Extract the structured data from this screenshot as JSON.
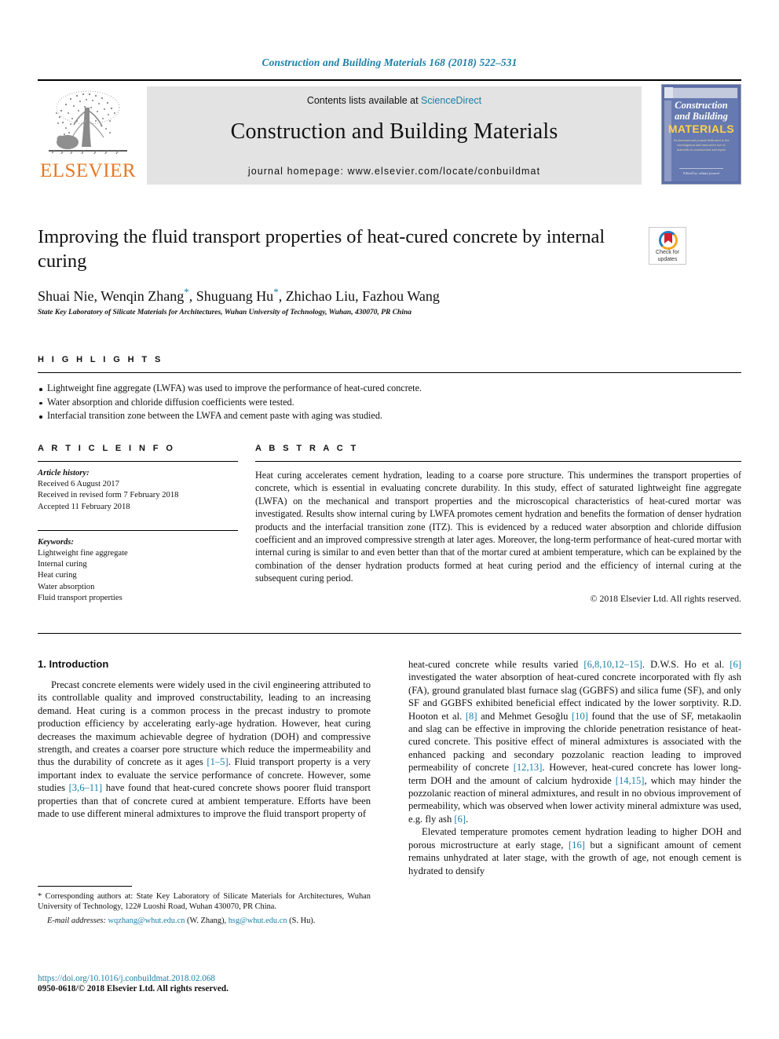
{
  "running_head": "Construction and Building Materials 168 (2018) 522–531",
  "masthead": {
    "publisher": "ELSEVIER",
    "contents_prefix": "Contents lists available at ",
    "contents_link": "ScienceDirect",
    "journal_name": "Construction and Building Materials",
    "homepage": "journal homepage: www.elsevier.com/locate/conbuildmat",
    "cover": {
      "line1": "Construction",
      "line2": "and Building",
      "line3": "MATERIALS",
      "blurb": "An international journal dedicated to the investigation and innovative use of materials in construction and repair",
      "foot": "Edited by: admin journal"
    }
  },
  "article": {
    "title": "Improving the fluid transport properties of heat-cured concrete by internal curing",
    "authors_html": "Shuai Nie, Wenqin Zhang *, Shuguang Hu *, Zhichao Liu, Fazhou Wang",
    "affiliation": "State Key Laboratory of Silicate Materials for Architectures, Wuhan University of Technology, Wuhan, 430070, PR China",
    "crossmark_label": "Check for updates"
  },
  "highlights": {
    "heading": "H I G H L I G H T S",
    "items": [
      "Lightweight fine aggregate (LWFA) was used to improve the performance of heat-cured concrete.",
      "Water absorption and chloride diffusion coefficients were tested.",
      "Interfacial transition zone between the LWFA and cement paste with aging was studied."
    ]
  },
  "article_info": {
    "heading": "A R T I C L E   I N F O",
    "history_label": "Article history:",
    "history": [
      "Received 6 August 2017",
      "Received in revised form 7 February 2018",
      "Accepted 11 February 2018"
    ],
    "keywords_label": "Keywords:",
    "keywords": [
      "Lightweight fine aggregate",
      "Internal curing",
      "Heat curing",
      "Water absorption",
      "Fluid transport properties"
    ]
  },
  "abstract": {
    "heading": "A B S T R A C T",
    "text": "Heat curing accelerates cement hydration, leading to a coarse pore structure. This undermines the transport properties of concrete, which is essential in evaluating concrete durability. In this study, effect of saturated lightweight fine aggregate (LWFA) on the mechanical and transport properties and the microscopical characteristics of heat-cured mortar was investigated. Results show internal curing by LWFA promotes cement hydration and benefits the formation of denser hydration products and the interfacial transition zone (ITZ). This is evidenced by a reduced water absorption and chloride diffusion coefficient and an improved compressive strength at later ages. Moreover, the long-term performance of heat-cured mortar with internal curing is similar to and even better than that of the mortar cured at ambient temperature, which can be explained by the combination of the denser hydration products formed at heat curing period and the efficiency of internal curing at the subsequent curing period.",
    "copyright": "© 2018 Elsevier Ltd. All rights reserved."
  },
  "body": {
    "section_heading": "1. Introduction",
    "left_paragraph_1": "Precast concrete elements were widely used in the civil engineering attributed to its controllable quality and improved constructability, leading to an increasing demand. Heat curing is a common process in the precast industry to promote production efficiency by accelerating early-age hydration. However, heat curing decreases the maximum achievable degree of hydration (DOH) and compressive strength, and creates a coarser pore structure which reduce the impermeability and thus the durability of concrete as it ages ",
    "left_ref_1": "[1–5]",
    "left_paragraph_1b": ". Fluid transport property is a very important index to evaluate the service performance of concrete. However, some studies ",
    "left_ref_2": "[3,6–11]",
    "left_paragraph_1c": " have found that heat-cured concrete shows poorer fluid transport properties than that of concrete cured at ambient temperature. Efforts have been made to use different mineral admixtures to improve the fluid transport property of",
    "right_paragraph_1a": "heat-cured concrete while results varied ",
    "right_ref_1": "[6,8,10,12–15]",
    "right_paragraph_1b": ". D.W.S. Ho et al. ",
    "right_ref_2": "[6]",
    "right_paragraph_1c": " investigated the water absorption of heat-cured concrete incorporated with fly ash (FA), ground granulated blast furnace slag (GGBFS) and silica fume (SF), and only SF and GGBFS exhibited beneficial effect indicated by the lower sorptivity. R.D. Hooton et al. ",
    "right_ref_3": "[8]",
    "right_paragraph_1d": " and Mehmet Gesoğlu ",
    "right_ref_4": "[10]",
    "right_paragraph_1e": " found that the use of SF, metakaolin and slag can be effective in improving the chloride penetration resistance of heat-cured concrete. This positive effect of mineral admixtures is associated with the enhanced packing and secondary pozzolanic reaction leading to improved permeability of concrete ",
    "right_ref_5": "[12,13]",
    "right_paragraph_1f": ". However, heat-cured concrete has lower long-term DOH and the amount of calcium hydroxide ",
    "right_ref_6": "[14,15]",
    "right_paragraph_1g": ", which may hinder the pozzolanic reaction of mineral admixtures, and result in no obvious improvement of permeability, which was observed when lower activity mineral admixture was used, e.g. fly ash ",
    "right_ref_7": "[6]",
    "right_paragraph_1h": ".",
    "right_paragraph_2a": "Elevated temperature promotes cement hydration leading to higher DOH and porous microstructure at early stage, ",
    "right_ref_8": "[16]",
    "right_paragraph_2b": " but a significant amount of cement remains unhydrated at later stage, with the growth of age, not enough cement is hydrated to densify"
  },
  "footnotes": {
    "corresponding": "* Corresponding authors at: State Key Laboratory of Silicate Materials for Architectures, Wuhan University of Technology, 122# Luoshi Road, Wuhan 430070, PR China.",
    "email_label": "E-mail addresses:",
    "email_1": "wqzhang@whut.edu.cn",
    "email_1_name": " (W. Zhang), ",
    "email_2": "hsg@whut.edu.cn",
    "email_2_name": " (S. Hu).",
    "doi": "https://doi.org/10.1016/j.conbuildmat.2018.02.068",
    "issn": "0950-0618/© 2018 Elsevier Ltd. All rights reserved."
  },
  "colors": {
    "link": "#1a7fa8",
    "elsevier_orange": "#E87722",
    "band_gray": "#e3e3e3"
  }
}
